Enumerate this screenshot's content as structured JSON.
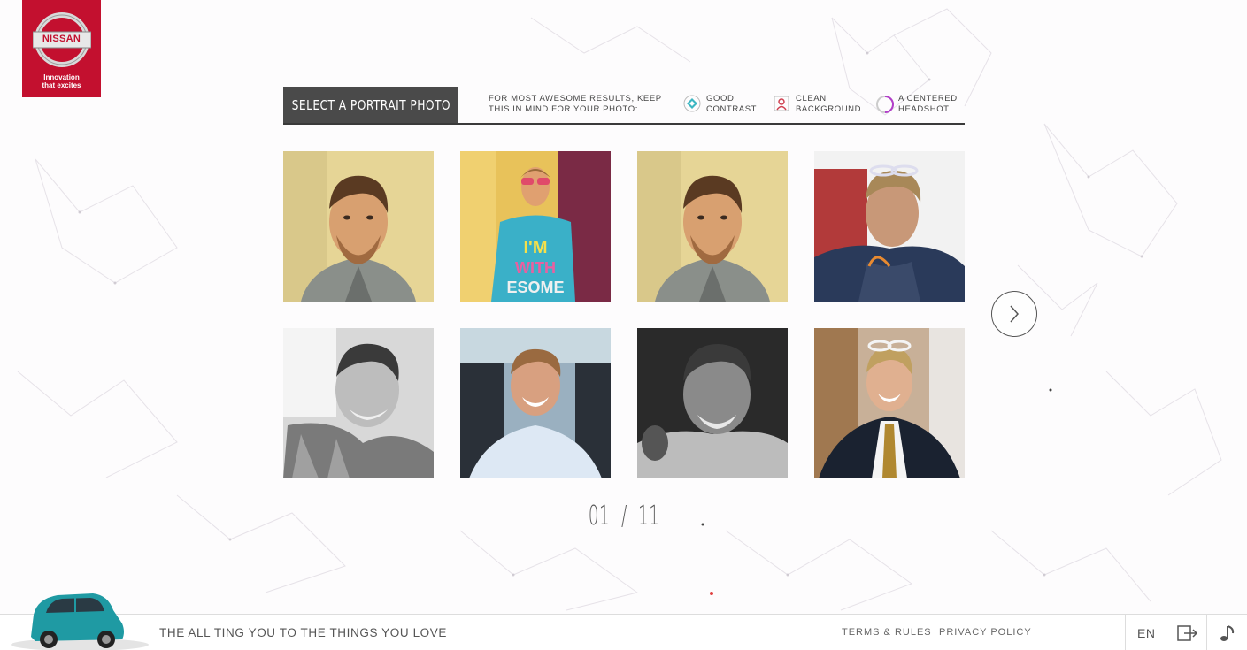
{
  "brand": {
    "name": "NISSAN",
    "tagline_line1": "Innovation",
    "tagline_line2": "that excites",
    "color": "#c3102f"
  },
  "header": {
    "title": "SELECT A PORTRAIT PHOTO",
    "intro_line1": "FOR MOST AWESOME RESULTS, KEEP",
    "intro_line2": "THIS IN MIND FOR YOUR PHOTO:",
    "tips": [
      {
        "icon": "contrast-icon",
        "line1": "GOOD",
        "line2": "CONTRAST"
      },
      {
        "icon": "background-icon",
        "line1": "CLEAN",
        "line2": "BACKGROUND"
      },
      {
        "icon": "headshot-icon",
        "line1": "A CENTERED",
        "line2": "HEADSHOT"
      }
    ]
  },
  "photos": [
    {
      "name": "photo-1",
      "style": "warm"
    },
    {
      "name": "photo-2",
      "style": "colorful"
    },
    {
      "name": "photo-3",
      "style": "warm"
    },
    {
      "name": "photo-4",
      "style": "outdoor"
    },
    {
      "name": "photo-5",
      "style": "bw"
    },
    {
      "name": "photo-6",
      "style": "blue-shirt"
    },
    {
      "name": "photo-7",
      "style": "bw"
    },
    {
      "name": "photo-8",
      "style": "suit"
    }
  ],
  "pager": {
    "current": "01",
    "separator": "/",
    "total": "11"
  },
  "next_icon": "chevron-right-icon",
  "footer": {
    "tagline": "THE ALL TING YOU TO THE THINGS YOU LOVE",
    "terms": "TERMS & RULES",
    "privacy": "PRIVACY POLICY",
    "language": "EN",
    "share_icon": "share-icon",
    "music_icon": "music-icon",
    "car_color": "#1f9aa3"
  }
}
